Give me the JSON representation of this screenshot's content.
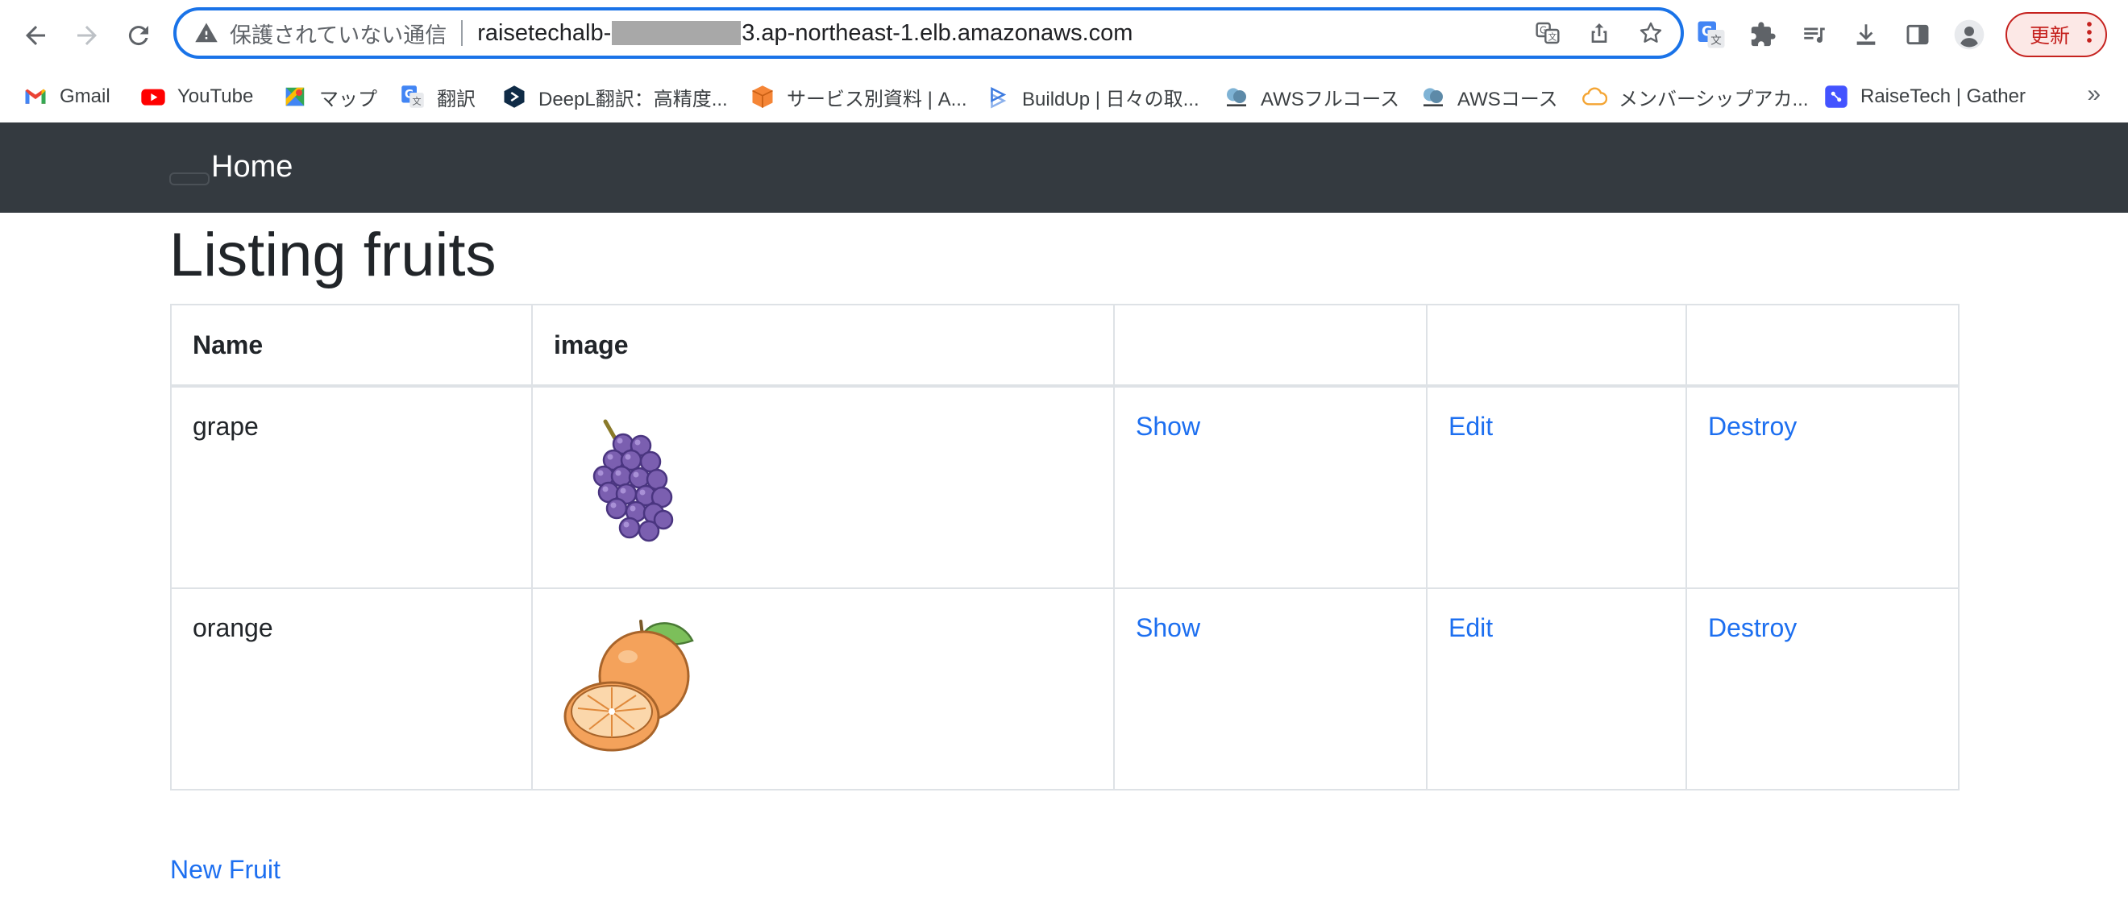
{
  "browser": {
    "insecure_label": "保護されていない通信",
    "url_prefix": "raisetechalb-",
    "url_suffix": "3.ap-northeast-1.elb.amazonaws.com",
    "update_label": "更新",
    "bookmarks_more": "»",
    "bookmarks": [
      {
        "label": "Gmail",
        "icon": "gmail-icon"
      },
      {
        "label": "YouTube",
        "icon": "youtube-icon"
      },
      {
        "label": "マップ",
        "icon": "maps-icon"
      },
      {
        "label": "翻訳",
        "icon": "translate-icon"
      },
      {
        "label": "DeepL翻訳：高精度...",
        "icon": "deepl-icon"
      },
      {
        "label": "サービス別資料 | A...",
        "icon": "aws-box-icon"
      },
      {
        "label": "BuildUp | 日々の取...",
        "icon": "buildup-icon"
      },
      {
        "label": "AWSフルコース",
        "icon": "aws-course-icon"
      },
      {
        "label": "AWSコース",
        "icon": "aws-course-icon"
      },
      {
        "label": "メンバーシップアカ...",
        "icon": "cloud-icon"
      },
      {
        "label": "RaiseTech | Gather",
        "icon": "gather-icon"
      }
    ]
  },
  "navbar": {
    "home": "Home"
  },
  "page": {
    "title": "Listing fruits",
    "table": {
      "headers": [
        "Name",
        "image",
        "",
        "",
        ""
      ],
      "rows": [
        {
          "name": "grape",
          "image": "grape-illustration",
          "show": "Show",
          "edit": "Edit",
          "destroy": "Destroy"
        },
        {
          "name": "orange",
          "image": "orange-illustration",
          "show": "Show",
          "edit": "Edit",
          "destroy": "Destroy"
        }
      ]
    },
    "new_link": "New Fruit"
  },
  "colors": {
    "omnibox_border": "#1a73e8",
    "navbar_bg": "#343a40",
    "link": "#1d6ff0",
    "update_button": "#c5221f"
  }
}
